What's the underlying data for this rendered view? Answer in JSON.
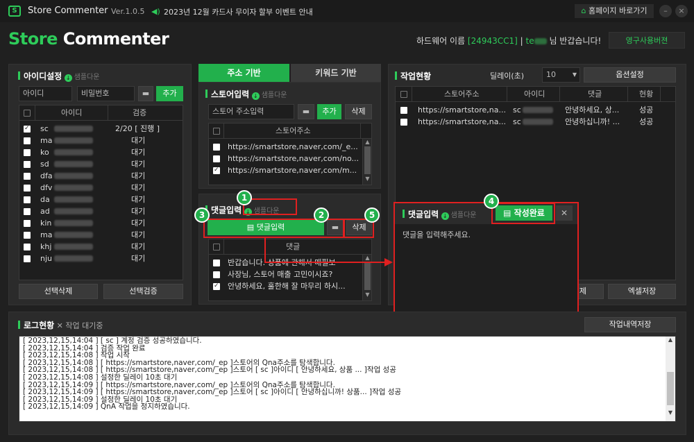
{
  "titlebar": {
    "logo_letter": "S",
    "app_name": "Store Commenter",
    "version": "Ver.1.0.5",
    "notice": "2023년 12월 카드사 무이자 할부 이벤트 안내",
    "home_button": "홈페이지 바로가기",
    "minimize": "–",
    "close": "×"
  },
  "header": {
    "brand_store": "Store",
    "brand_commenter": "Commenter",
    "hw_prefix": "하드웨어 이름",
    "hw_id": "[24943CC1]",
    "hw_sep": "|",
    "user_prefix": "te",
    "user_suffix": "님 반갑습니다!",
    "perm_button": "영구사용버젼"
  },
  "id_panel": {
    "title": "아이디설정",
    "sample": "샘플다운",
    "id_placeholder": "아이디",
    "pw_placeholder": "비밀번호",
    "add_button": "추가",
    "col_id": "아이디",
    "col_verify": "검증",
    "rows": [
      {
        "id": "sc",
        "status": "2/20 [ 진행 ]",
        "checked": true
      },
      {
        "id": "ma",
        "status": "대기",
        "checked": false
      },
      {
        "id": "ko",
        "status": "대기",
        "checked": false
      },
      {
        "id": "sd",
        "status": "대기",
        "checked": false
      },
      {
        "id": "dfa",
        "status": "대기",
        "checked": false
      },
      {
        "id": "dfv",
        "status": "대기",
        "checked": false
      },
      {
        "id": "da",
        "status": "대기",
        "checked": false
      },
      {
        "id": "ad",
        "status": "대기",
        "checked": false
      },
      {
        "id": "kin",
        "status": "대기",
        "checked": false
      },
      {
        "id": "ma",
        "status": "대기",
        "checked": false
      },
      {
        "id": "khj",
        "status": "대기",
        "checked": false
      },
      {
        "id": "nju",
        "status": "대기",
        "checked": false
      }
    ],
    "delete_button": "선택삭제",
    "verify_button": "선택검증"
  },
  "store_panel": {
    "tab_address": "주소 기반",
    "tab_keyword": "키워드 기반",
    "title": "스토어입력",
    "sample": "샘플다운",
    "input_placeholder": "스토어 주소입력",
    "add_button": "추가",
    "delete_button": "삭제",
    "col_header": "스토어주소",
    "rows": [
      {
        "url": "https://smartstore,naver,com/_e...",
        "checked": false
      },
      {
        "url": "https://smartstore,naver,com/no...",
        "checked": false
      },
      {
        "url": "https://smartstore,naver,com/m...",
        "checked": true
      }
    ]
  },
  "comment_panel": {
    "title": "댓글입력",
    "sample": "샘플다운",
    "input_button": "댓글입력",
    "delete_button": "삭제",
    "col_header": "댓글",
    "rows": [
      {
        "text": "반갑습니다. 상품에 관해서 매필보",
        "checked": false
      },
      {
        "text": "사장님, 스토어 매출 고민이시죠?",
        "checked": false
      },
      {
        "text": "안녕하세요, 훌한해 잘 마무리 하시...",
        "checked": true
      }
    ]
  },
  "status_panel": {
    "title": "작업현황",
    "delay_label": "딜레이(초)",
    "delay_value": "10",
    "options_button": "옵션설정",
    "col_store": "스토어주소",
    "col_id": "아이디",
    "col_comment": "댓글",
    "col_status": "현황",
    "rows": [
      {
        "store": "https://smartstore,na...",
        "id": "sc",
        "comment": "안녕하세요, 상...",
        "status": "성공"
      },
      {
        "store": "https://smartstore,na...",
        "id": "sc",
        "comment": "안녕하십니까! ...",
        "status": "성공"
      }
    ],
    "delete_button_tail": "제",
    "excel_button": "엑셀저장"
  },
  "popup": {
    "title": "댓글입력",
    "sample": "샘플다운",
    "complete_button": "작성완료",
    "close": "✕",
    "placeholder": "댓글을 입력해주세요."
  },
  "callouts": [
    "1",
    "2",
    "3",
    "4",
    "5"
  ],
  "log_panel": {
    "title": "로그현황",
    "state": "✕ 작업 대기중",
    "save_button": "작업내역저장",
    "lines": [
      "[ 2023,12,15,14:04 ] [ sc          ] 계정 검증 성공하였습니다.",
      "[ 2023,12,15,14:04 ] 검증 작업 완료",
      "[ 2023,12,15,14:08 ] 작업 시작",
      "[ 2023,12,15,14:08 ] [ https://smartstore,naver,com/_ep                    ]스토어의 Qna주소를 탐색합니다.",
      "[ 2023,12,15,14:08 ] [ https://smartstore,naver,com/_ep                    ]스토어 [ sc          ]아이디 [ 안녕하세요, 상품 ... ]작업 성공",
      "[ 2023,12,15,14:08 ] 설정한 딜레이 10초 대기",
      "[ 2023,12,15,14:09 ] [ https://smartstore,naver,com/_ep          ]스토어의 Qna주소를 탐색합니다.",
      "[ 2023,12,15,14:09 ] [ https://smartstore,naver,com/_ep                    ]스토어 [ sc          ]아이디 [ 안녕하십니까! 상품... ]작업 성공",
      "[ 2023,12,15,14:09 ] 설정한 딜레이 10초 대기",
      "[ 2023,12,15,14:09 ] QnA 작업을 정지하였습니다."
    ]
  },
  "colors": {
    "accent": "#22b04c",
    "callout_red": "#e02020",
    "bg": "#202020"
  }
}
